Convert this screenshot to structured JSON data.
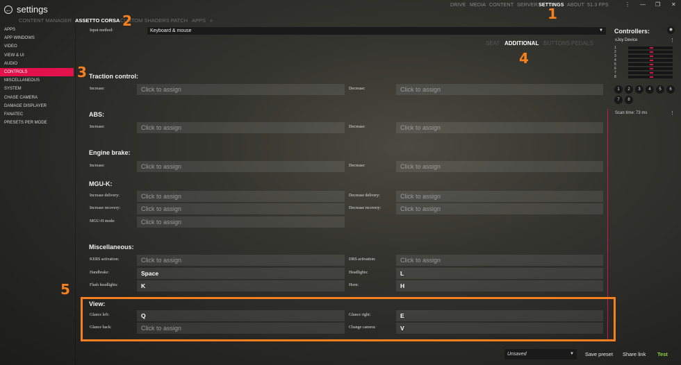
{
  "app": {
    "title": "settings",
    "back_icon": "back-arrow-icon"
  },
  "topnav": [
    "DRIVE",
    "MEDIA",
    "CONTENT",
    "SERVER",
    "SETTINGS",
    "ABOUT",
    "51.3 FPS"
  ],
  "window_controls": [
    "⋮",
    "—",
    "❐",
    "✕"
  ],
  "subtabs": [
    "CONTENT MANAGER",
    "ASSETTO CORSA",
    "CUSTOM SHADERS PATCH",
    "APPS"
  ],
  "sidebar": [
    "APPS",
    "APP WINDOWS",
    "VIDEO",
    "VIEW & UI",
    "AUDIO",
    "CONTROLS",
    "MISCELLANEOUS",
    "SYSTEM",
    "CHASE CAMERA",
    "DAMAGE DISPLAYER",
    "FANATEC",
    "PRESETS PER MODE"
  ],
  "input_method": {
    "label": "Input method:",
    "value": "Keyboard & mouse"
  },
  "right_tabs": [
    "SEAT",
    "ADDITIONAL",
    "BUTTONS",
    "PEDALS"
  ],
  "sections": {
    "traction": {
      "title": "Traction control:",
      "increase_label": "Increase:",
      "increase": "Click to assign",
      "decrease_label": "Decrease:",
      "decrease": "Click to assign"
    },
    "abs": {
      "title": "ABS:",
      "increase_label": "Increase:",
      "increase": "Click to assign",
      "decrease_label": "Decrease:",
      "decrease": "Click to assign"
    },
    "engine": {
      "title": "Engine brake:",
      "increase_label": "Increase:",
      "increase": "Click to assign",
      "decrease_label": "Decrease:",
      "decrease": "Click to assign"
    },
    "mguk": {
      "title": "MGU-K:",
      "inc_delivery_label": "Increase delivery:",
      "inc_delivery": "Click to assign",
      "dec_delivery_label": "Decrease delivery:",
      "dec_delivery": "Click to assign",
      "inc_recovery_label": "Increase recovery:",
      "inc_recovery": "Click to assign",
      "dec_recovery_label": "Decrease recovery:",
      "dec_recovery": "Click to assign",
      "mguh_label": "MGU-H mode:",
      "mguh": "Click to assign"
    },
    "misc": {
      "title": "Miscellaneous:",
      "kers_label": "KERS activation:",
      "kers": "Click to assign",
      "drs_label": "DRS activation:",
      "drs": "Click to assign",
      "handbrake_label": "Handbrake:",
      "handbrake": "Space",
      "headlights_label": "Headlights:",
      "headlights": "L",
      "flash_label": "Flash headlights:",
      "flash": "K",
      "horn_label": "Horn:",
      "horn": "H"
    },
    "view": {
      "title": "View:",
      "glance_left_label": "Glance left:",
      "glance_left": "Q",
      "glance_right_label": "Glance right:",
      "glance_right": "E",
      "glance_back_label": "Glance back:",
      "glance_back": "Click to assign",
      "change_camera_label": "Change camera:",
      "change_camera": "V"
    }
  },
  "controllers": {
    "title": "Controllers:",
    "device": "vJoy Device",
    "axes": [
      "1",
      "2",
      "3",
      "4",
      "5",
      "6",
      "7",
      "8"
    ],
    "buttons": [
      "1",
      "2",
      "3",
      "4",
      "5",
      "6",
      "7",
      "8"
    ],
    "scan_time": "Scan time: 73 ms"
  },
  "annotations": [
    "1",
    "2",
    "3",
    "4",
    "5"
  ],
  "bottom": {
    "preset": "Unsaved",
    "save_preset": "Save preset",
    "share_link": "Share link",
    "test": "Test"
  },
  "colors": {
    "accent": "#e1124c",
    "annotation": "#f7801e",
    "test": "#8fd63d"
  }
}
